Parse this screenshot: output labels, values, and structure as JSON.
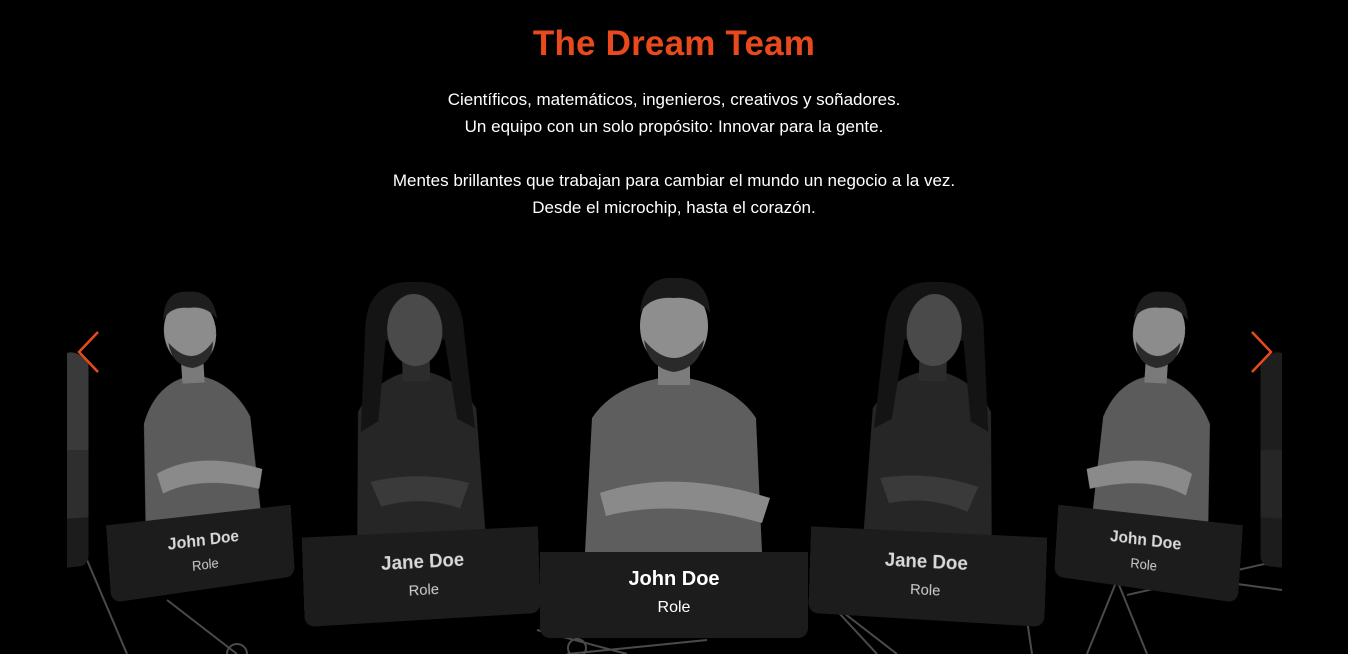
{
  "section": {
    "title": "The Dream Team",
    "intro_line_1": "Científicos, matemáticos, ingenieros, creativos y soñadores.",
    "intro_line_2": "Un equipo con un solo propósito: Innovar para la gente.",
    "intro_line_3": "Mentes brillantes que trabajan para cambiar el mundo un negocio a la vez.",
    "intro_line_4": "Desde el microchip, hasta el corazón."
  },
  "carousel": {
    "prev_icon": "chevron-left-icon",
    "next_icon": "chevron-right-icon",
    "arrow_color": "#e84a1e",
    "members": [
      {
        "name": "John Doe",
        "role": "Role"
      },
      {
        "name": "Jane Doe",
        "role": "Role"
      },
      {
        "name": "John Doe",
        "role": "Role"
      },
      {
        "name": "Jane Doe",
        "role": "Role"
      },
      {
        "name": "John Doe",
        "role": "Role"
      }
    ]
  },
  "colors": {
    "accent": "#e84a1e",
    "background": "#000000",
    "plate": "#1c1c1c"
  }
}
